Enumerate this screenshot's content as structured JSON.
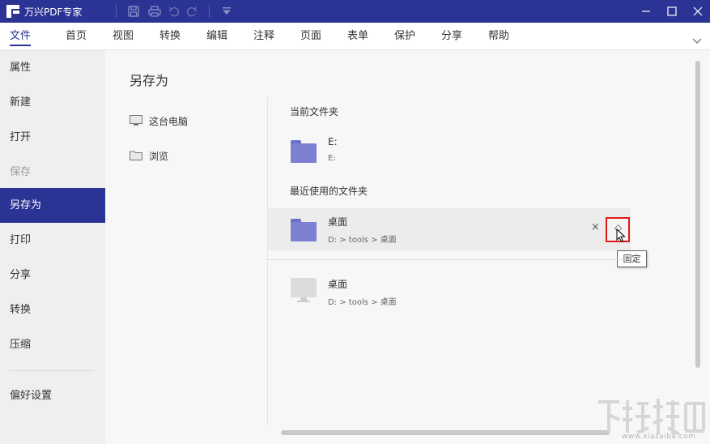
{
  "app": {
    "title": "万兴PDF专家"
  },
  "quick_access": {
    "icons": [
      "save-icon",
      "print-icon",
      "undo-icon",
      "redo-icon",
      "customize-dropdown-icon"
    ]
  },
  "window_controls": {
    "icons": [
      "minimize-icon",
      "maximize-icon",
      "close-icon"
    ]
  },
  "menu": {
    "items": [
      "文件",
      "首页",
      "视图",
      "转换",
      "编辑",
      "注释",
      "页面",
      "表单",
      "保护",
      "分享",
      "帮助"
    ],
    "active": "文件"
  },
  "sidebar": {
    "items": [
      {
        "label": "属性",
        "state": "normal"
      },
      {
        "label": "新建",
        "state": "normal"
      },
      {
        "label": "打开",
        "state": "normal"
      },
      {
        "label": "保存",
        "state": "disabled"
      },
      {
        "label": "另存为",
        "state": "active"
      },
      {
        "label": "打印",
        "state": "normal"
      },
      {
        "label": "分享",
        "state": "normal"
      },
      {
        "label": "转换",
        "state": "normal"
      },
      {
        "label": "压缩",
        "state": "normal"
      },
      {
        "label": "偏好设置",
        "state": "normal"
      }
    ]
  },
  "panel": {
    "title": "另存为",
    "locations": [
      {
        "label": "这台电脑",
        "icon": "computer-icon"
      },
      {
        "label": "浏览",
        "icon": "folder-icon"
      }
    ],
    "current_folder": {
      "heading": "当前文件夹",
      "name": "E:",
      "path": "E:"
    },
    "recent": {
      "heading": "最近使用的文件夹",
      "items": [
        {
          "name": "桌面",
          "path": "D: > tools > 桌面",
          "icon": "folder-icon",
          "remove_label": "×",
          "pin_label": "◇"
        },
        {
          "name": "桌面",
          "path": "D: > tools > 桌面",
          "icon": "desktop-icon"
        }
      ]
    },
    "tooltip": "固定"
  },
  "watermark": {
    "text": "www.xiazaiba.com"
  },
  "colors": {
    "accent": "#2b3394",
    "highlight": "#e01a1a",
    "folder": "#7b80d1"
  }
}
